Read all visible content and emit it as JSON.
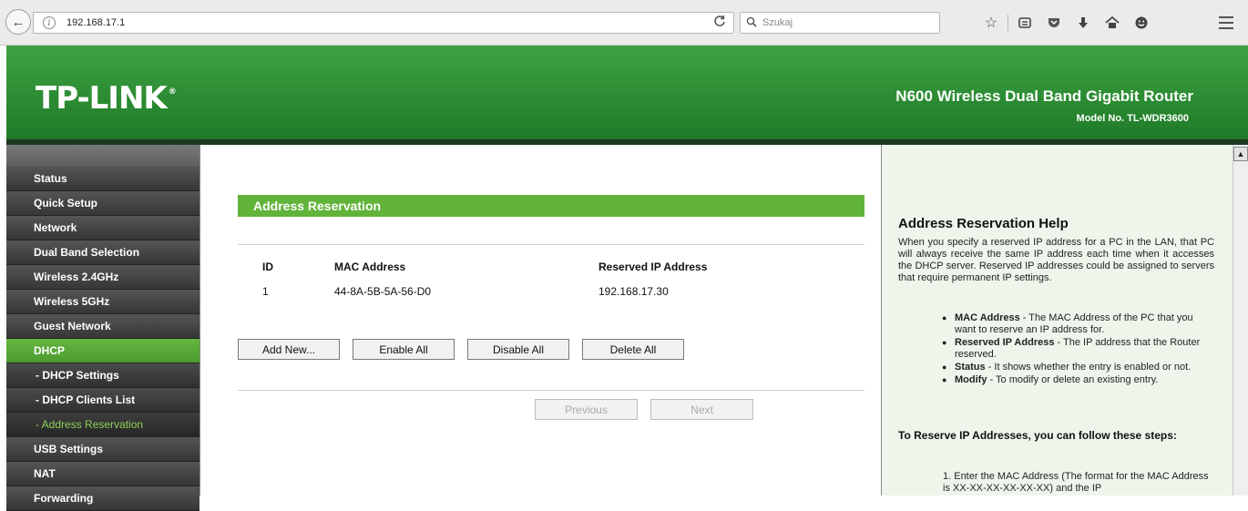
{
  "browser": {
    "url": "192.168.17.1",
    "search_placeholder": "Szukaj",
    "back_glyph": "←",
    "reload_glyph": "C",
    "toolbar_icons": [
      "star-icon",
      "reading-list-icon",
      "pocket-icon",
      "download-icon",
      "home-icon",
      "smiley-icon"
    ]
  },
  "header": {
    "logo": "TP-LINK",
    "logo_mark": "®",
    "product_name": "N600 Wireless Dual Band Gigabit Router",
    "model_no": "Model No. TL-WDR3600"
  },
  "nav": {
    "items": [
      {
        "label": "Status"
      },
      {
        "label": "Quick Setup"
      },
      {
        "label": "Network"
      },
      {
        "label": "Dual Band Selection"
      },
      {
        "label": "Wireless 2.4GHz"
      },
      {
        "label": "Wireless 5GHz"
      },
      {
        "label": "Guest Network"
      },
      {
        "label": "DHCP"
      },
      {
        "label": "- DHCP Settings"
      },
      {
        "label": "- DHCP Clients List"
      },
      {
        "label": "- Address Reservation"
      },
      {
        "label": "USB Settings"
      },
      {
        "label": "NAT"
      },
      {
        "label": "Forwarding"
      }
    ]
  },
  "main": {
    "section_title": "Address Reservation",
    "table": {
      "headers": [
        "ID",
        "MAC Address",
        "Reserved IP Address"
      ],
      "rows": [
        {
          "id": "1",
          "mac": "44-8A-5B-5A-56-D0",
          "ip": "192.168.17.30"
        }
      ]
    },
    "buttons": {
      "add_new": "Add New...",
      "enable_all": "Enable All",
      "disable_all": "Disable All",
      "delete_all": "Delete All",
      "previous": "Previous",
      "next": "Next"
    }
  },
  "help": {
    "title": "Address Reservation Help",
    "intro": "When you specify a reserved IP address for a PC in the LAN, that PC will always receive the same IP address each time when it accesses the DHCP server. Reserved IP addresses could be assigned to servers that require permanent IP settings.",
    "items": [
      {
        "term": "MAC Address",
        "desc": " - The MAC Address of the PC that you want to reserve an IP address for."
      },
      {
        "term": "Reserved IP Address",
        "desc": " - The IP address that the Router reserved."
      },
      {
        "term": "Status",
        "desc": " - It shows whether the entry is enabled or not."
      },
      {
        "term": "Modify",
        "desc": " - To modify or delete an existing entry."
      }
    ],
    "steps_title": "To Reserve IP Addresses, you can follow these steps:",
    "step1": "1. Enter the MAC Address (The format for the MAC Address is XX-XX-XX-XX-XX-XX) and the IP"
  }
}
